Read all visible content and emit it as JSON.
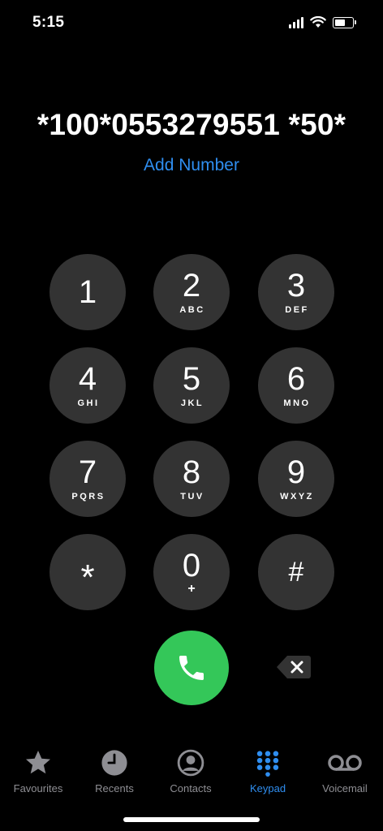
{
  "status_bar": {
    "time": "5:15"
  },
  "display": {
    "dialed_number": "*100*0553279551 *50*",
    "add_number": "Add Number"
  },
  "keypad": [
    {
      "digit": "1",
      "letters": ""
    },
    {
      "digit": "2",
      "letters": "ABC"
    },
    {
      "digit": "3",
      "letters": "DEF"
    },
    {
      "digit": "4",
      "letters": "GHI"
    },
    {
      "digit": "5",
      "letters": "JKL"
    },
    {
      "digit": "6",
      "letters": "MNO"
    },
    {
      "digit": "7",
      "letters": "PQRS"
    },
    {
      "digit": "8",
      "letters": "TUV"
    },
    {
      "digit": "9",
      "letters": "WXYZ"
    },
    {
      "digit": "*",
      "letters": ""
    },
    {
      "digit": "0",
      "letters": "+"
    },
    {
      "digit": "#",
      "letters": ""
    }
  ],
  "actions": {
    "call_icon": "phone-icon",
    "delete_icon": "backspace-icon"
  },
  "tabs": [
    {
      "label": "Favourites",
      "icon": "star-icon",
      "active": false
    },
    {
      "label": "Recents",
      "icon": "clock-icon",
      "active": false
    },
    {
      "label": "Contacts",
      "icon": "person-circle-icon",
      "active": false
    },
    {
      "label": "Keypad",
      "icon": "keypad-grid-icon",
      "active": true
    },
    {
      "label": "Voicemail",
      "icon": "voicemail-icon",
      "active": false
    }
  ],
  "colors": {
    "accent": "#2f8ef0",
    "call": "#34c759",
    "key_bg": "#333333",
    "inactive_tab": "#8e8e93"
  }
}
